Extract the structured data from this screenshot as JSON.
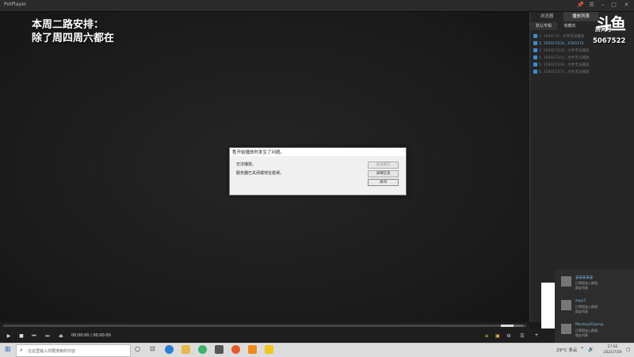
{
  "window": {
    "title": "PotPlayer"
  },
  "overlay": {
    "line1": "本周二路安排：",
    "line2": "除了周四周六都在"
  },
  "dialog": {
    "title": "在开始播放时发生了问题。",
    "message1": "无法播放。",
    "message2": "服务器已关闭或地址错误。",
    "btn_report": "发送报告",
    "btn_details": "详细信息",
    "btn_close": "关闭"
  },
  "panel": {
    "tab1": "浏览器",
    "tab2": "播放列表",
    "subtab1": "默认专辑",
    "subtab2": "收藏夹",
    "items": [
      "1. 1593172...文件无法播放",
      "2. 1593172(3)...1593172",
      "3. 1593172(4)...文件无法播放",
      "4. 1593172(5)...文件无法播放",
      "5. 1593172(6)...文件无法播放",
      "6. 1593172(7)...文件无法播放"
    ]
  },
  "logo": {
    "glyph": "斗鱼",
    "room_label": "房间号",
    "room_number": "5067522"
  },
  "controls": {
    "time": "00:00:00 / 00:00:00"
  },
  "notifications": [
    {
      "name": "安安安安安",
      "line1": "已将您加入群组",
      "line2": "群友列表"
    },
    {
      "name": "zayy1",
      "line1": "已将您加入群组",
      "line2": "群友列表"
    },
    {
      "name": "Monkey2Gaang",
      "line1": "已将您加入群组",
      "line2": "群友列表"
    }
  ],
  "taskbar": {
    "search_placeholder": "在这里输入你要搜索的内容",
    "weather": "29°C 多云",
    "time": "17:02",
    "date": "2021/7/20"
  },
  "colors": {
    "accent": "#3b8fd8",
    "dialog_bg": "#f0f0f0",
    "video_bg": "#1b1b1b"
  }
}
